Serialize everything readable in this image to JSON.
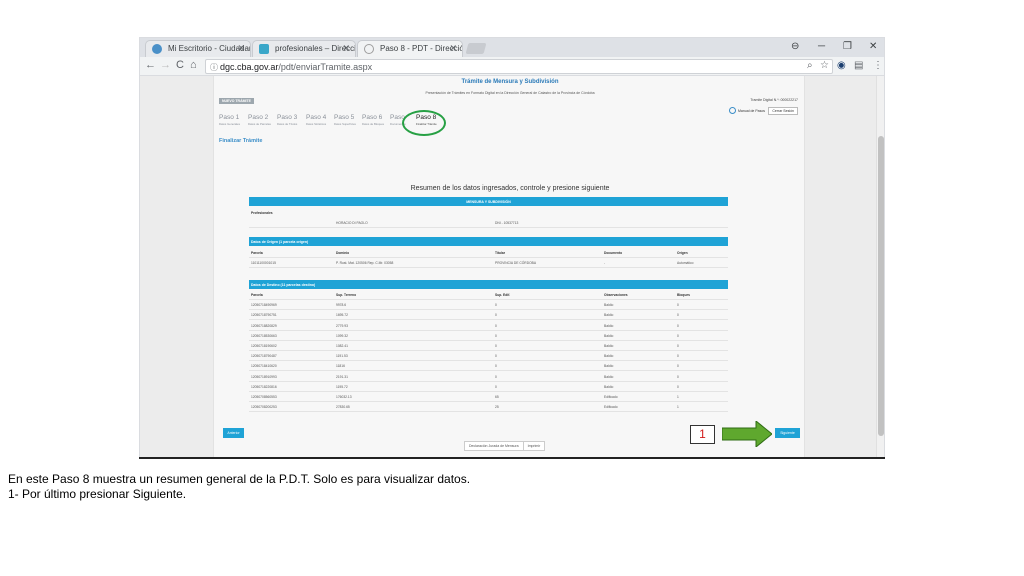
{
  "browser": {
    "tabs": [
      {
        "label": "Mi Escritorio - Ciudadano",
        "favicon_color": "#4a90c8"
      },
      {
        "label": "profesionales – Direcció",
        "favicon_color": "#3aa7c9"
      },
      {
        "label": "Paso 8 - PDT - Dirección",
        "favicon_color": "#9e9e9e"
      }
    ],
    "close_glyph": "✕",
    "window_controls": [
      "⊖",
      "─",
      "❐",
      "✕"
    ],
    "nav": {
      "back": "←",
      "forward": "→",
      "reload": "C",
      "home": "⌂"
    },
    "url": {
      "lock": "ⓘ",
      "host": "dgc.cba.gov.ar",
      "path": "/pdt/enviarTramite.aspx"
    },
    "toolbar_icons": {
      "zoom": "⌕",
      "star": "☆",
      "ext1": "◉",
      "ext2": "▤",
      "menu": "⋮"
    }
  },
  "page": {
    "title": "Trámite de Mensura y Subdivisión",
    "subtitle": "Presentación de Trámites en Formato Digital en la Dirección General de Catastro de la Provincia de Córdoba",
    "tramite_badge": "NUEVO TRÁMITE",
    "tramite_number": "Tramite Digital N.º: 000022217",
    "manual_label": "Manual de Pasos",
    "cerrar_label": "Cerrar Sesión",
    "steps": [
      {
        "label": "Paso 1",
        "sub": "Datos Generales"
      },
      {
        "label": "Paso 2",
        "sub": "Datos de Parcelas"
      },
      {
        "label": "Paso 3",
        "sub": "Datos de Títulos"
      },
      {
        "label": "Paso 4",
        "sub": "Datos Sintéticos"
      },
      {
        "label": "Paso 5",
        "sub": "Datos Superficies"
      },
      {
        "label": "Paso 6",
        "sub": "Datos de Bloques"
      },
      {
        "label": "Paso 7",
        "sub": "Documentos"
      },
      {
        "label": "Paso 8",
        "sub": "Finalizar Trámite"
      }
    ],
    "finalizar_heading": "Finalizar Trámite",
    "summary_heading": "Resumen de los datos ingresados, controle y presione siguiente",
    "section_main": "MENSURA Y SUBDIVISIÓN",
    "profesionales": {
      "label": "Profesionales",
      "name": "HORACIO DI PAOLO",
      "dni": "DNI - 10537713"
    },
    "origen": {
      "title": "Datos de Origen (1 parcela origen)",
      "headers": [
        "Parcela",
        "Dominio",
        "Titular",
        "Documento",
        "Origen"
      ],
      "rows": [
        [
          "11011100001015",
          "P. Rust. Mat. 120506 Rep. C.Mr. 03058",
          "PROVINCIA DE CÓRDOBA",
          "-",
          "Automático"
        ]
      ]
    },
    "destino": {
      "title": "Datos de Destino (11 parcelas destino)",
      "headers": [
        "Parcela",
        "Sup. Terreno",
        "Sup. Edif.",
        "Observaciones",
        "Bloques"
      ],
      "rows": [
        [
          "12050718490969",
          "9978.6",
          "0",
          "Baldío",
          "0"
        ],
        [
          "12050718790751",
          "1695.72",
          "0",
          "Baldío",
          "0"
        ],
        [
          "12050718820829",
          "2779.93",
          "0",
          "Baldío",
          "0"
        ],
        [
          "12050718530663",
          "1099.32",
          "0",
          "Baldío",
          "0"
        ],
        [
          "12050718190602",
          "1082.41",
          "0",
          "Baldío",
          "0"
        ],
        [
          "12050718790487",
          "1191.53",
          "0",
          "Baldío",
          "0"
        ],
        [
          "12050718410620",
          "11816",
          "0",
          "Baldío",
          "0"
        ],
        [
          "12050718910993",
          "2191.31",
          "0",
          "Baldío",
          "0"
        ],
        [
          "12050718220816",
          "1195.72",
          "0",
          "Baldío",
          "0"
        ],
        [
          "12050708560553",
          "176032.13",
          "65",
          "Edificado",
          "1"
        ],
        [
          "12050708200253",
          "27830.65",
          "25",
          "Edificado",
          "1"
        ]
      ]
    },
    "anterior_label": "Anterior",
    "siguiente_label": "Siguiente",
    "bottom_buttons": [
      "Declaración Jurada de Mensura",
      "Imprimir"
    ]
  },
  "annotation": {
    "number": "1",
    "highlight_color": "#27a044",
    "arrow_color": "#5fa82e"
  },
  "caption": {
    "line1": "En este Paso 8 muestra un resumen general de la P.D.T. Solo es para visualizar datos.",
    "line2": "1- Por último presionar Siguiente."
  }
}
